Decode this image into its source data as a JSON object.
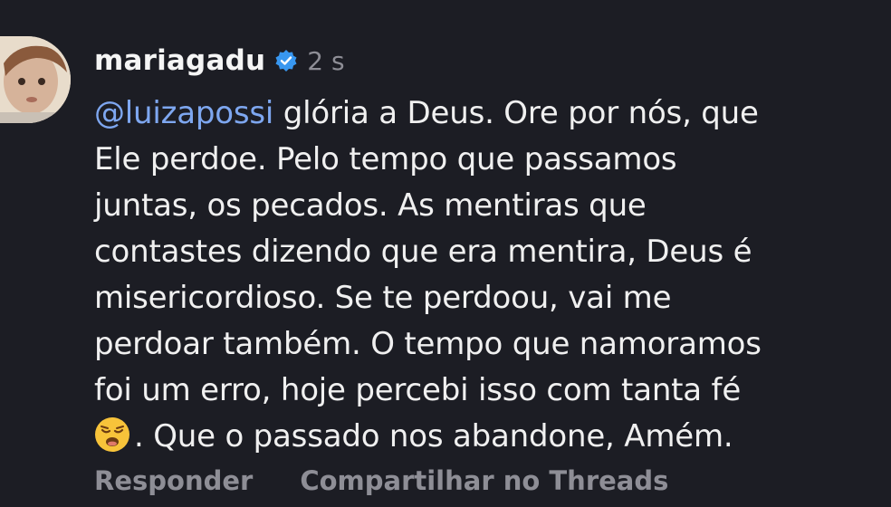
{
  "comment": {
    "username": "mariagadu",
    "verified": true,
    "time": "2 s",
    "mention": "@luizapossi",
    "lines": [
      " glória a Deus.  Ore por nós, que",
      "Ele perdoe. Pelo tempo que passamos",
      "juntas, os pecados. As mentiras que",
      "contastes dizendo que era mentira, Deus é",
      "misericordioso. Se te perdoou, vai me",
      "perdoar também. O tempo que namoramos",
      "foi um erro, hoje percebi isso com tanta fé",
      ". Que o passado nos abandone,  Amém."
    ],
    "emoji": "tired-face-emoji"
  },
  "actions": {
    "reply_label": "Responder",
    "share_label": "Compartilhar no Threads"
  },
  "colors": {
    "background": "#1c1d24",
    "mention": "#7ea7f0",
    "verified": "#3897f0",
    "muted": "#8e8e96"
  }
}
